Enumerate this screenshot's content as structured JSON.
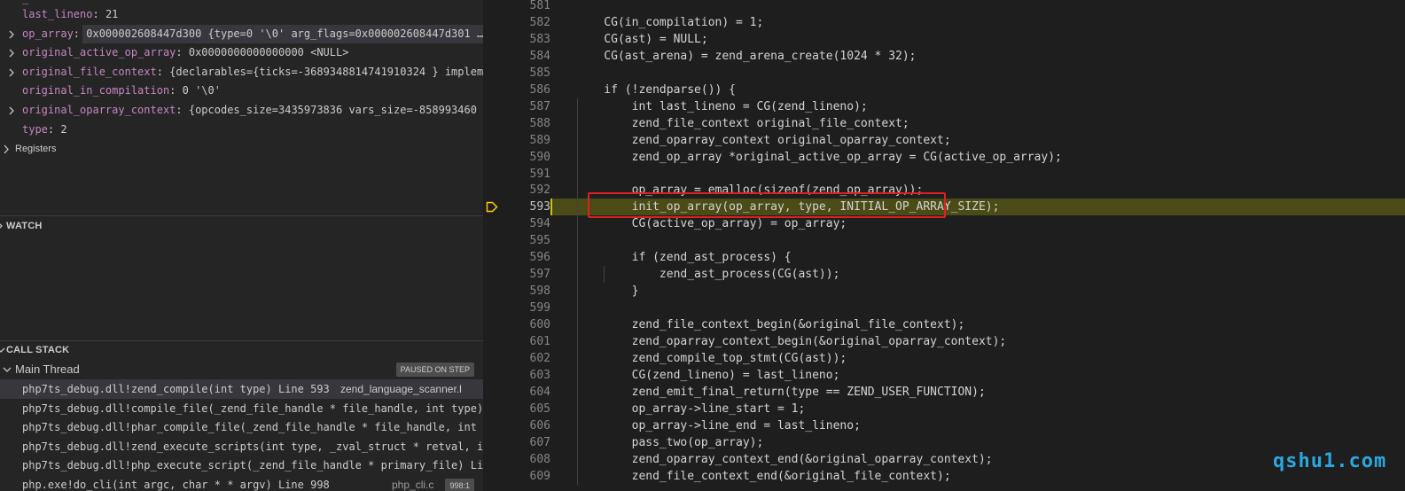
{
  "variables": {
    "rows": [
      {
        "name": "last_lineno",
        "value": "21",
        "expandable": false
      },
      {
        "name": "op_array",
        "value": "0x000002608447d300 {type=0 '\\0' arg_flags=0x000002608447d301 …",
        "expandable": true,
        "selected": true
      },
      {
        "name": "original_active_op_array",
        "value": "0x0000000000000000 <NULL>",
        "expandable": true
      },
      {
        "name": "original_file_context",
        "value": "{declarables={ticks=-3689348814741910324 } implem…",
        "expandable": true
      },
      {
        "name": "original_in_compilation",
        "value": "0 '\\0'",
        "expandable": false
      },
      {
        "name": "original_oparray_context",
        "value": "{opcodes_size=3435973836 vars_size=-858993460 …",
        "expandable": true
      },
      {
        "name": "type",
        "value": "2",
        "expandable": false
      }
    ],
    "registers_label": "Registers"
  },
  "watch": {
    "title": "WATCH"
  },
  "call_stack": {
    "title": "CALL STACK",
    "thread": "Main Thread",
    "status_badge": "PAUSED ON STEP",
    "frames": [
      {
        "fn": "php7ts_debug.dll!zend_compile(int type) Line 593",
        "src": "zend_language_scanner.l",
        "active": true
      },
      {
        "fn": "php7ts_debug.dll!compile_file(_zend_file_handle * file_handle, int type) L",
        "src": ""
      },
      {
        "fn": "php7ts_debug.dll!phar_compile_file(_zend_file_handle * file_handle, int ty",
        "src": ""
      },
      {
        "fn": "php7ts_debug.dll!zend_execute_scripts(int type, _zval_struct * retval, int",
        "src": ""
      },
      {
        "fn": "php7ts_debug.dll!php_execute_script(_zend_file_handle * primary_file) Line",
        "src": ""
      },
      {
        "fn": "php.exe!do_cli(int argc, char * * argv) Line 998",
        "src": "php_cli.c",
        "badge": "998:1"
      }
    ]
  },
  "editor": {
    "current_line": 593,
    "lines": [
      {
        "n": 581,
        "text": ""
      },
      {
        "n": 582,
        "text": "    CG(in_compilation) = 1;"
      },
      {
        "n": 583,
        "text": "    CG(ast) = NULL;"
      },
      {
        "n": 584,
        "text": "    CG(ast_arena) = zend_arena_create(1024 * 32);"
      },
      {
        "n": 585,
        "text": ""
      },
      {
        "n": 586,
        "text": "    if (!zendparse()) {"
      },
      {
        "n": 587,
        "text": "        int last_lineno = CG(zend_lineno);"
      },
      {
        "n": 588,
        "text": "        zend_file_context original_file_context;"
      },
      {
        "n": 589,
        "text": "        zend_oparray_context original_oparray_context;"
      },
      {
        "n": 590,
        "text": "        zend_op_array *original_active_op_array = CG(active_op_array);"
      },
      {
        "n": 591,
        "text": ""
      },
      {
        "n": 592,
        "text": "        op_array = emalloc(sizeof(zend_op_array));"
      },
      {
        "n": 593,
        "text": "        init_op_array(op_array, type, INITIAL_OP_ARRAY_SIZE);"
      },
      {
        "n": 594,
        "text": "        CG(active_op_array) = op_array;"
      },
      {
        "n": 595,
        "text": ""
      },
      {
        "n": 596,
        "text": "        if (zend_ast_process) {"
      },
      {
        "n": 597,
        "text": "            zend_ast_process(CG(ast));"
      },
      {
        "n": 598,
        "text": "        }"
      },
      {
        "n": 599,
        "text": ""
      },
      {
        "n": 600,
        "text": "        zend_file_context_begin(&original_file_context);"
      },
      {
        "n": 601,
        "text": "        zend_oparray_context_begin(&original_oparray_context);"
      },
      {
        "n": 602,
        "text": "        zend_compile_top_stmt(CG(ast));"
      },
      {
        "n": 603,
        "text": "        CG(zend_lineno) = last_lineno;"
      },
      {
        "n": 604,
        "text": "        zend_emit_final_return(type == ZEND_USER_FUNCTION);"
      },
      {
        "n": 605,
        "text": "        op_array->line_start = 1;"
      },
      {
        "n": 606,
        "text": "        op_array->line_end = last_lineno;"
      },
      {
        "n": 607,
        "text": "        pass_two(op_array);"
      },
      {
        "n": 608,
        "text": "        zend_oparray_context_end(&original_oparray_context);"
      },
      {
        "n": 609,
        "text": "        zend_file_context_end(&original_file_context);"
      }
    ]
  },
  "watermark": "qshu1.com",
  "colors": {
    "variable_name": "#c586c0",
    "current_line_bg": "#4b4b18",
    "highlight_box": "#e02020",
    "watermark": "#2aa7e0"
  }
}
